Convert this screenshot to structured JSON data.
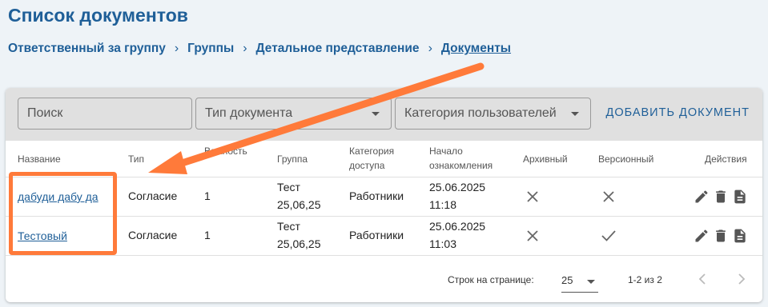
{
  "page": {
    "title": "Список документов"
  },
  "breadcrumbs": [
    {
      "label": "Ответственный за группу"
    },
    {
      "label": "Группы"
    },
    {
      "label": "Детальное представление"
    },
    {
      "label": "Документы"
    }
  ],
  "toolbar": {
    "search_placeholder": "Поиск",
    "doc_type_placeholder": "Тип документа",
    "user_category_placeholder": "Категория пользователей",
    "add_label": "ДОБАВИТЬ ДОКУМЕНТ"
  },
  "table": {
    "headers": {
      "name": "Название",
      "type": "Тип",
      "priority": "Важность",
      "group": "Группа",
      "category_1": "Категория",
      "category_2": "доступа",
      "start_1": "Начало",
      "start_2": "ознакомления",
      "archived": "Архивный",
      "versioned": "Версионный",
      "actions": "Действия"
    },
    "rows": [
      {
        "name": "дабуди дабу да",
        "type": "Согласие",
        "priority": "1",
        "group_1": "Тест",
        "group_2": "25,06,25",
        "category": "Работники",
        "date": "25.06.2025",
        "time": "11:18",
        "archived_icon": "close-icon",
        "versioned_icon": "close-icon"
      },
      {
        "name": "Тестовый",
        "type": "Согласие",
        "priority": "1",
        "group_1": "Тест",
        "group_2": "25,06,25",
        "category": "Работники",
        "date": "25.06.2025",
        "time": "11:03",
        "archived_icon": "close-icon",
        "versioned_icon": "check-icon"
      }
    ]
  },
  "pagination": {
    "rows_per_page_label": "Строк на странице:",
    "rows_per_page_value": "25",
    "range_label": "1-2 из 2"
  },
  "colors": {
    "accent": "#1f5f98",
    "highlight": "#ff7a3a"
  }
}
